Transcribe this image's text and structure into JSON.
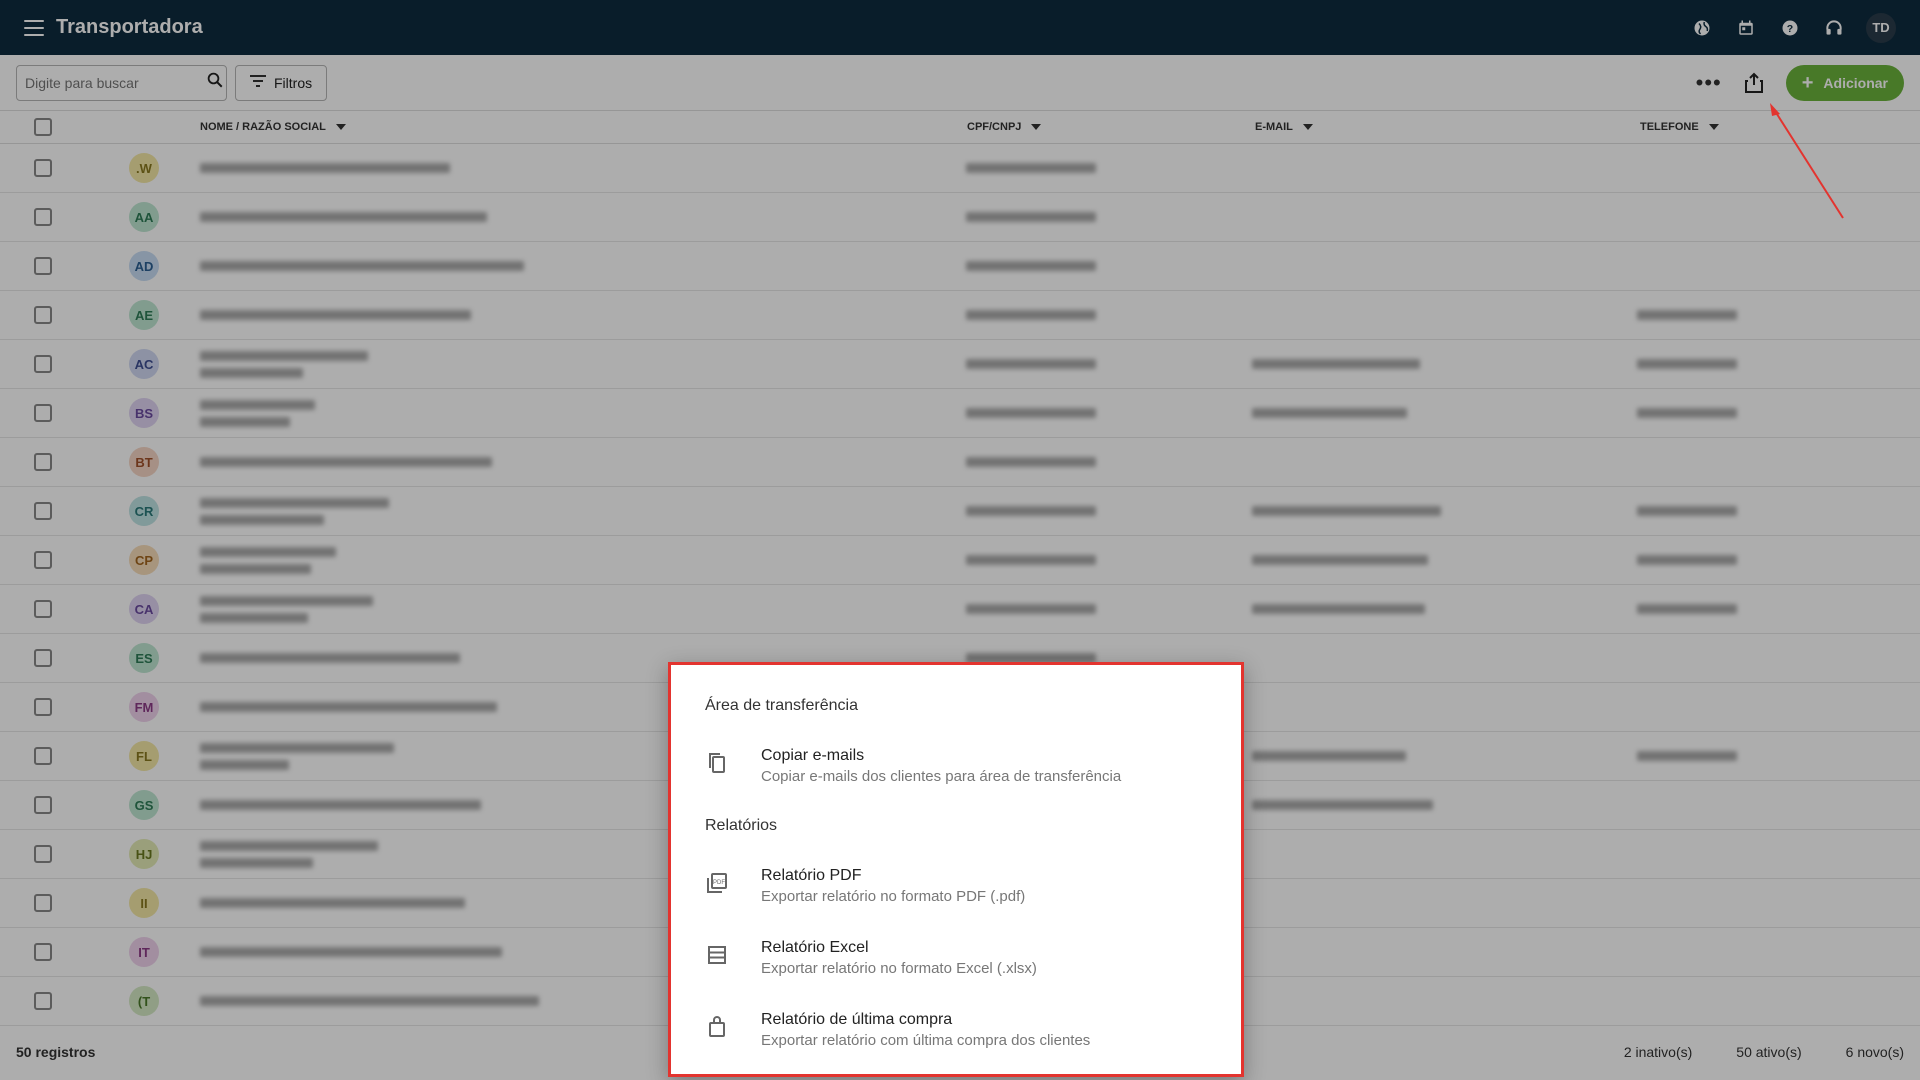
{
  "app": {
    "title": "Transportadora",
    "user_initials": "TD"
  },
  "toolbar": {
    "search_placeholder": "Digite para buscar",
    "filters_label": "Filtros",
    "more_label": "•••",
    "add_label": "Adicionar"
  },
  "table": {
    "columns": [
      "NOME / RAZÃO SOCIAL",
      "CPF/CNPJ",
      "E-MAIL",
      "TELEFONE"
    ],
    "rows": [
      {
        "initials": ".W",
        "color": "#f3e7a6",
        "fg": "#8a7a20",
        "two_line": false,
        "email": false,
        "phone": false
      },
      {
        "initials": "AA",
        "color": "#bfe6d2",
        "fg": "#2e7d57",
        "two_line": false,
        "email": false,
        "phone": false
      },
      {
        "initials": "AD",
        "color": "#c7dcf3",
        "fg": "#2b5f92",
        "two_line": false,
        "email": false,
        "phone": false
      },
      {
        "initials": "AE",
        "color": "#bfe6d2",
        "fg": "#2e7d57",
        "two_line": false,
        "email": false,
        "phone": true
      },
      {
        "initials": "AC",
        "color": "#d0d8f2",
        "fg": "#3e4f92",
        "two_line": true,
        "email": true,
        "phone": true
      },
      {
        "initials": "BS",
        "color": "#dfd3f2",
        "fg": "#6a4aa0",
        "two_line": true,
        "email": true,
        "phone": true
      },
      {
        "initials": "BT",
        "color": "#f5d5c4",
        "fg": "#a1502a",
        "two_line": false,
        "email": false,
        "phone": false
      },
      {
        "initials": "CR",
        "color": "#bfe3e3",
        "fg": "#2a7a7a",
        "two_line": true,
        "email": true,
        "phone": true
      },
      {
        "initials": "CP",
        "color": "#f6dcb8",
        "fg": "#a2651e",
        "two_line": true,
        "email": true,
        "phone": true
      },
      {
        "initials": "CA",
        "color": "#dfd3f2",
        "fg": "#6a4aa0",
        "two_line": true,
        "email": true,
        "phone": true
      },
      {
        "initials": "ES",
        "color": "#bfe6d2",
        "fg": "#2e7d57",
        "two_line": false,
        "email": false,
        "phone": false
      },
      {
        "initials": "FM",
        "color": "#efd1ec",
        "fg": "#8d3a86",
        "two_line": false,
        "email": false,
        "phone": false
      },
      {
        "initials": "FL",
        "color": "#f3e7a6",
        "fg": "#8a7a20",
        "two_line": true,
        "email": true,
        "phone": true
      },
      {
        "initials": "GS",
        "color": "#bfe6d2",
        "fg": "#2e7d57",
        "two_line": false,
        "email": true,
        "phone": false
      },
      {
        "initials": "HJ",
        "color": "#e3ebb5",
        "fg": "#6a7a20",
        "two_line": true,
        "email": false,
        "phone": false
      },
      {
        "initials": "II",
        "color": "#f3e7a6",
        "fg": "#8a7a20",
        "two_line": false,
        "email": false,
        "phone": false
      },
      {
        "initials": "IT",
        "color": "#efd1ec",
        "fg": "#8d3a86",
        "two_line": false,
        "email": false,
        "phone": false
      },
      {
        "initials": "(T",
        "color": "#d4e9c4",
        "fg": "#4b7a2a",
        "two_line": false,
        "email": false,
        "phone": false
      }
    ]
  },
  "footer": {
    "count": "50 registros",
    "inactive": "2 inativo(s)",
    "active": "50 ativo(s)",
    "new": "6 novo(s)"
  },
  "popup": {
    "section1": "Área de transferência",
    "section2": "Relatórios",
    "items": [
      {
        "title": "Copiar e-mails",
        "sub": "Copiar e-mails dos clientes para área de transferência",
        "icon": "copy-icon"
      },
      {
        "title": "Relatório PDF",
        "sub": "Exportar relatório no formato PDF (.pdf)",
        "icon": "pdf-icon"
      },
      {
        "title": "Relatório Excel",
        "sub": "Exportar relatório no formato Excel (.xlsx)",
        "icon": "excel-icon"
      },
      {
        "title": "Relatório de última compra",
        "sub": "Exportar relatório com última compra dos clientes",
        "icon": "shopping-bag-icon"
      }
    ]
  },
  "colors": {
    "topbar": "#0e2b3e",
    "accent": "#6ab33b",
    "highlight": "#e3342f"
  }
}
